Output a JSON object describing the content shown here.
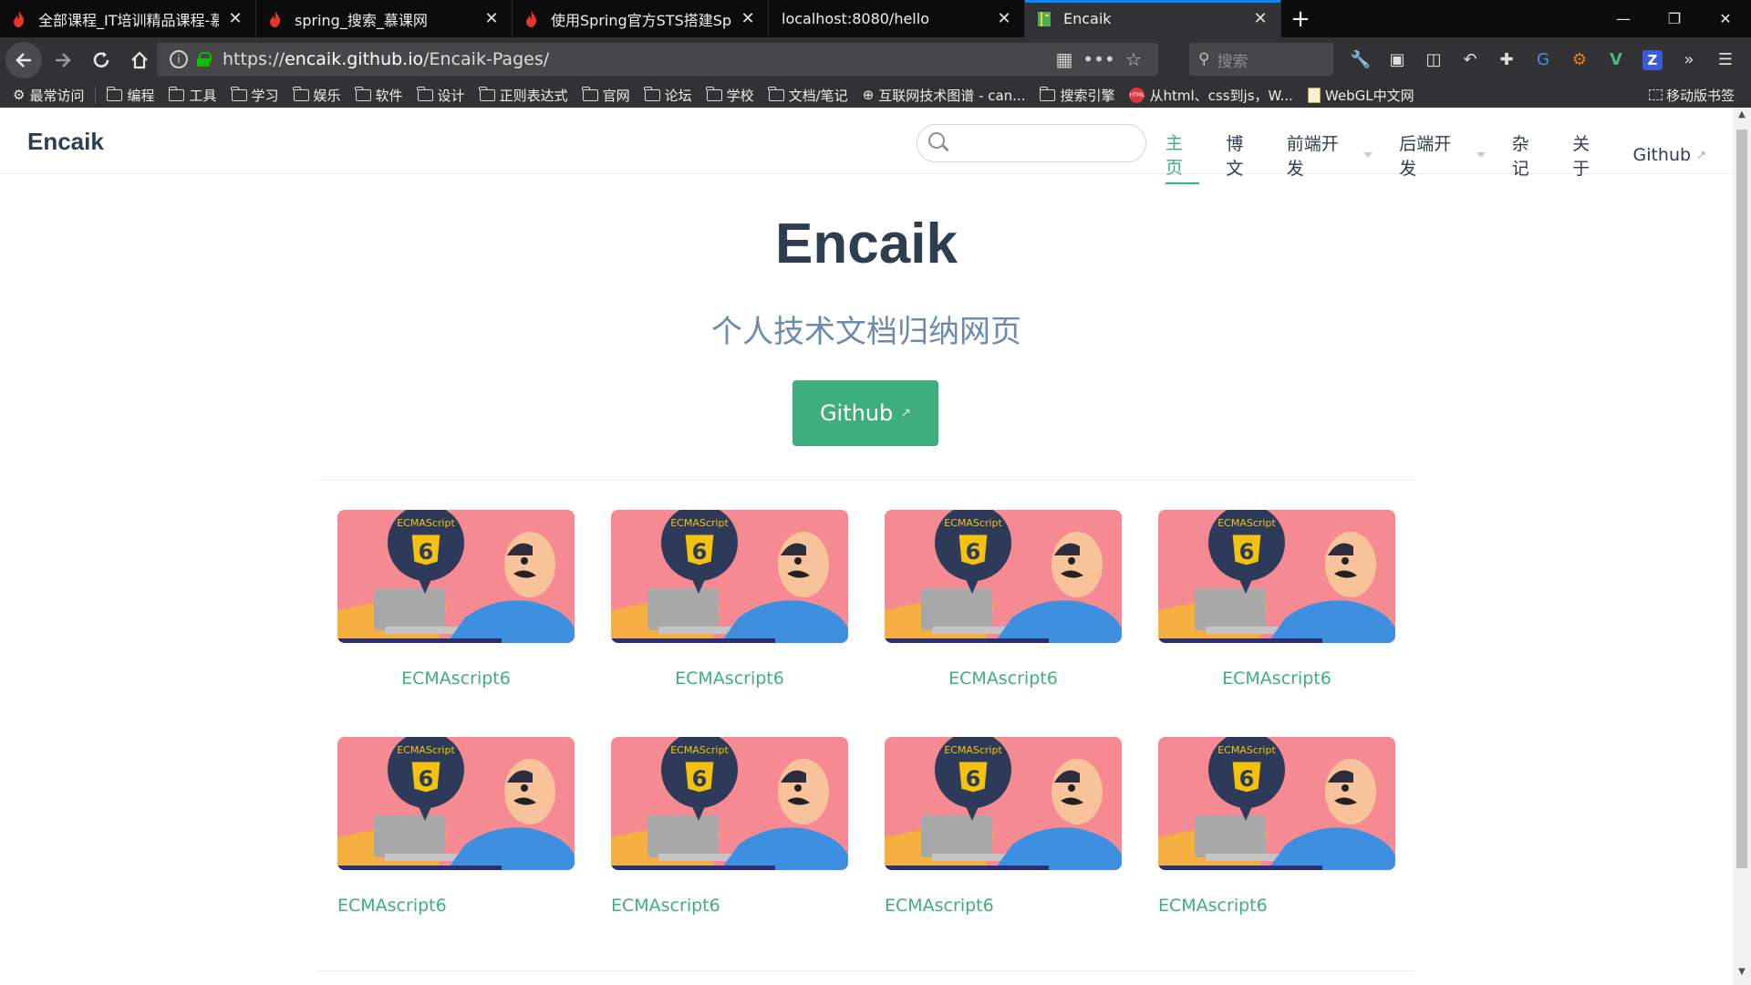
{
  "browser": {
    "tabs": [
      {
        "title": "全部课程_IT培训精品课程-慕课",
        "active": false
      },
      {
        "title": "spring_搜索_慕课网",
        "active": false
      },
      {
        "title": "使用Spring官方STS搭建Sprin",
        "active": false
      },
      {
        "title": "localhost:8080/hello",
        "active": false
      },
      {
        "title": "Encaik",
        "active": true
      }
    ],
    "url_prefix": "https://",
    "url_host": "encaik.github.io",
    "url_path": "/Encaik-Pages/",
    "search_placeholder": "搜索",
    "bookmarks": [
      "最常访问",
      "编程",
      "工具",
      "学习",
      "娱乐",
      "软件",
      "设计",
      "正则表达式",
      "官网",
      "论坛",
      "学校",
      "文档/笔记",
      "互联网技术图谱 - can...",
      "搜索引擎",
      "从html、css到js，W...",
      "WebGL中文网"
    ],
    "mobile_bookmarks": "移动版书签"
  },
  "site": {
    "brand": "Encaik",
    "nav": [
      {
        "label": "主页",
        "active": true
      },
      {
        "label": "博文"
      },
      {
        "label": "前端开发",
        "dropdown": true
      },
      {
        "label": "后端开发",
        "dropdown": true
      },
      {
        "label": "杂记"
      },
      {
        "label": "关于"
      },
      {
        "label": "Github",
        "external": true
      }
    ],
    "hero_title": "Encaik",
    "hero_subtitle": "个人技术文档归纳网页",
    "hero_button": "Github",
    "thumb_badge": "ECMAScript",
    "thumb_number": "6",
    "cards": [
      {
        "label": "ECMAscript6"
      },
      {
        "label": "ECMAscript6"
      },
      {
        "label": "ECMAscript6"
      },
      {
        "label": "ECMAscript6"
      },
      {
        "label": "ECMAscript6"
      },
      {
        "label": "ECMAscript6"
      },
      {
        "label": "ECMAscript6"
      },
      {
        "label": "ECMAscript6"
      }
    ]
  },
  "colors": {
    "accent": "#3eaf7c",
    "heading": "#2c3e50",
    "subtitle": "#6a8bad",
    "thumb_bg": "#f58a92"
  }
}
